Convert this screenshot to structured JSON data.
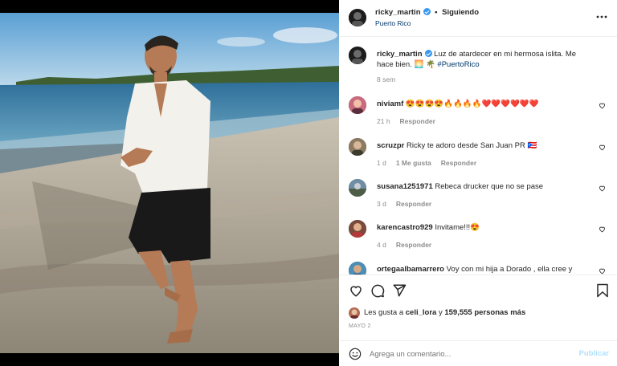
{
  "post": {
    "username": "ricky_martin",
    "follow_status": "Siguiendo",
    "location": "Puerto Rico",
    "caption": {
      "text": "Luz de atardecer en mi hermosa islita. Me hace bien.",
      "emoji": "🌅 🌴",
      "hashtag": "#PuertoRico"
    },
    "age": "8 sem"
  },
  "comments": [
    {
      "username": "niviamf",
      "text": "😍😍😍😍🔥🔥🔥🔥❤️❤️❤️❤️❤️❤️",
      "time": "21 h",
      "likes": "",
      "reply": "Responder"
    },
    {
      "username": "scruzpr",
      "text": "Ricky te adoro desde San Juan PR 🇵🇷",
      "time": "1 d",
      "likes": "1 Me gusta",
      "reply": "Responder"
    },
    {
      "username": "susana1251971",
      "text": "Rebeca drucker que no se pase",
      "time": "3 d",
      "likes": "",
      "reply": "Responder"
    },
    {
      "username": "karencastro929",
      "text": "Invitame!!!😍",
      "time": "4 d",
      "likes": "",
      "reply": "Responder"
    },
    {
      "username": "ortegaalbamarrero",
      "text": "Voy con mi hija a Dorado , ella cree y",
      "time": "",
      "likes": "",
      "reply": ""
    }
  ],
  "likes_line": {
    "prefix": "Les gusta a",
    "user": "celi_lora",
    "connector": "y",
    "count": "159,555 personas más"
  },
  "date": "MAYO 2",
  "footer": {
    "placeholder": "Agrega un comentario...",
    "publish": "Publicar"
  },
  "colors": {
    "verified": "#3897f0",
    "link": "#00376b",
    "publish_disabled": "#b2dffc",
    "secondary_text": "#8e8e8e"
  },
  "icons": [
    "more-options-icon",
    "heart-icon",
    "comment-icon",
    "share-icon",
    "bookmark-icon",
    "emoji-icon",
    "verified-badge-icon"
  ]
}
